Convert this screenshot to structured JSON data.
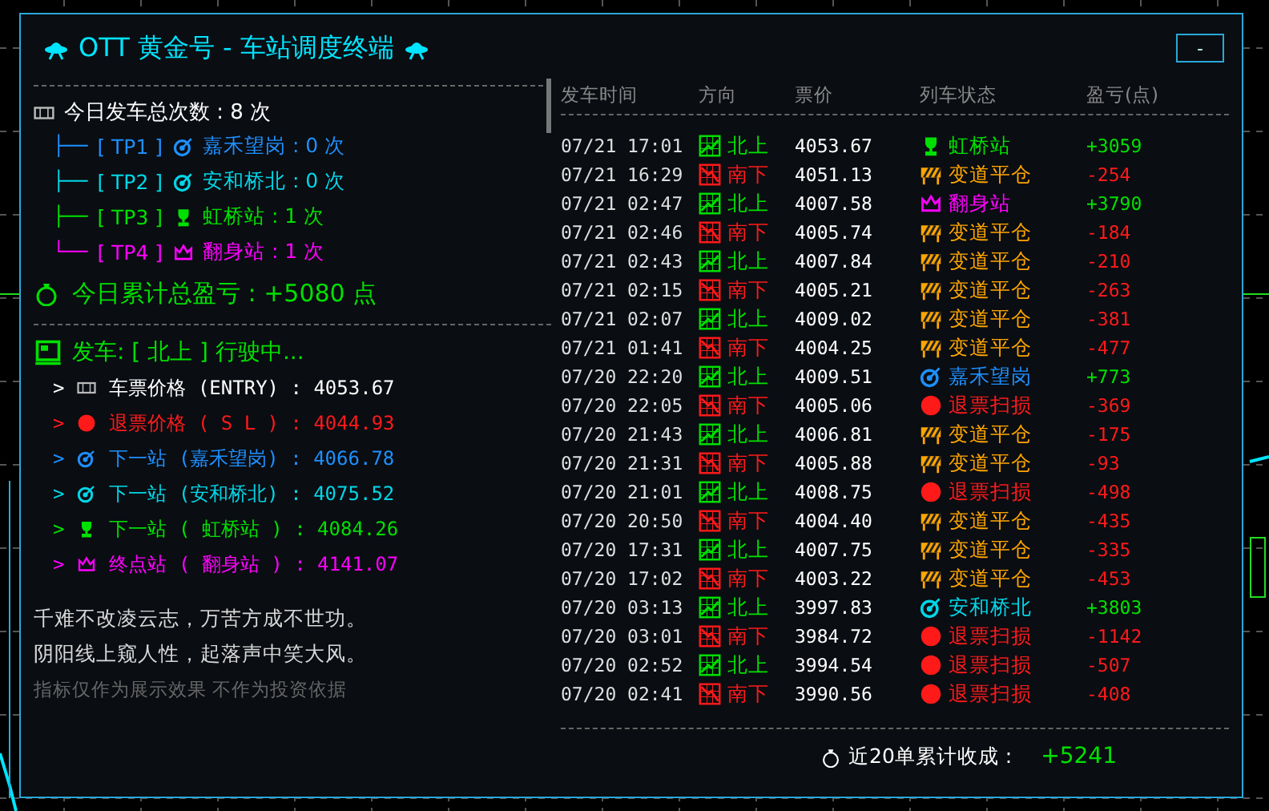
{
  "title": {
    "text": "OTT 黄金号 - 车站调度终端"
  },
  "minimize_button": {
    "label": "-"
  },
  "summary": {
    "text": "今日发车总次数 : 8 次"
  },
  "branches": [
    {
      "prefix": "├──",
      "tag": "[ TP1 ]",
      "station": "嘉禾望岗 : 0 次",
      "kind": "target",
      "color": "#1e90ff"
    },
    {
      "prefix": "├──",
      "tag": "[ TP2 ]",
      "station": "安和桥北 : 0 次",
      "kind": "target",
      "color": "#00d7e8"
    },
    {
      "prefix": "├──",
      "tag": "[ TP3 ]",
      "station": "虹桥站 : 1 次",
      "kind": "trophy",
      "color": "#00e000"
    },
    {
      "prefix": "└──",
      "tag": "[ TP4 ]",
      "station": "翻身站 : 1 次",
      "kind": "crown",
      "color": "#ff00ff"
    }
  ],
  "total": {
    "text": "今日累计总盈亏 : +5080 点"
  },
  "departure": {
    "text": "发车: [ 北上 ] 行驶中..."
  },
  "levels": [
    {
      "arrow": ">",
      "text": "车票价格 (ENTRY) : 4053.67",
      "kind": "ticket",
      "color": "#ffffff"
    },
    {
      "arrow": ">",
      "text": "退票价格 ( S L ) : 4044.93",
      "kind": "stop",
      "color": "#ff1a1a"
    },
    {
      "arrow": ">",
      "text": "下一站 (嘉禾望岗) : 4066.78",
      "kind": "target",
      "color": "#1e90ff"
    },
    {
      "arrow": ">",
      "text": "下一站 (安和桥北) : 4075.52",
      "kind": "target",
      "color": "#00d7e8"
    },
    {
      "arrow": ">",
      "text": "下一站 ( 虹桥站 ) : 4084.26",
      "kind": "trophy",
      "color": "#00e000"
    },
    {
      "arrow": ">",
      "text": "终点站 ( 翻身站 ) : 4141.07",
      "kind": "crown",
      "color": "#ff00ff"
    }
  ],
  "poem": [
    "千难不改凌云志，万苦方成不世功。",
    "阴阳线上窥人性，起落声中笑大风。"
  ],
  "disclaimer": "指标仅作为展示效果 不作为投资依据",
  "table": {
    "columns": [
      "发车时间",
      "方向",
      "票价",
      "列车状态",
      "盈亏(点)"
    ],
    "rows": [
      {
        "time": "07/21 17:01",
        "direction": {
          "kind": "up",
          "text": "北上"
        },
        "price": "4053.67",
        "status": {
          "kind": "trophy",
          "text": "虹桥站",
          "color": "#00e000"
        },
        "pnl": "+3059",
        "gain": true
      },
      {
        "time": "07/21 16:29",
        "direction": {
          "kind": "down",
          "text": "南下"
        },
        "price": "4051.13",
        "status": {
          "kind": "barrier",
          "text": "变道平仓",
          "color": "#ffa500"
        },
        "pnl": "-254",
        "gain": false
      },
      {
        "time": "07/21 02:47",
        "direction": {
          "kind": "up",
          "text": "北上"
        },
        "price": "4007.58",
        "status": {
          "kind": "crown",
          "text": "翻身站",
          "color": "#ff00ff"
        },
        "pnl": "+3790",
        "gain": true
      },
      {
        "time": "07/21 02:46",
        "direction": {
          "kind": "down",
          "text": "南下"
        },
        "price": "4005.74",
        "status": {
          "kind": "barrier",
          "text": "变道平仓",
          "color": "#ffa500"
        },
        "pnl": "-184",
        "gain": false
      },
      {
        "time": "07/21 02:43",
        "direction": {
          "kind": "up",
          "text": "北上"
        },
        "price": "4007.84",
        "status": {
          "kind": "barrier",
          "text": "变道平仓",
          "color": "#ffa500"
        },
        "pnl": "-210",
        "gain": false
      },
      {
        "time": "07/21 02:15",
        "direction": {
          "kind": "down",
          "text": "南下"
        },
        "price": "4005.21",
        "status": {
          "kind": "barrier",
          "text": "变道平仓",
          "color": "#ffa500"
        },
        "pnl": "-263",
        "gain": false
      },
      {
        "time": "07/21 02:07",
        "direction": {
          "kind": "up",
          "text": "北上"
        },
        "price": "4009.02",
        "status": {
          "kind": "barrier",
          "text": "变道平仓",
          "color": "#ffa500"
        },
        "pnl": "-381",
        "gain": false
      },
      {
        "time": "07/21 01:41",
        "direction": {
          "kind": "down",
          "text": "南下"
        },
        "price": "4004.25",
        "status": {
          "kind": "barrier",
          "text": "变道平仓",
          "color": "#ffa500"
        },
        "pnl": "-477",
        "gain": false
      },
      {
        "time": "07/20 22:20",
        "direction": {
          "kind": "up",
          "text": "北上"
        },
        "price": "4009.51",
        "status": {
          "kind": "target",
          "text": "嘉禾望岗",
          "color": "#1e90ff"
        },
        "pnl": "+773",
        "gain": true
      },
      {
        "time": "07/20 22:05",
        "direction": {
          "kind": "down",
          "text": "南下"
        },
        "price": "4005.06",
        "status": {
          "kind": "stop",
          "text": "退票扫损",
          "color": "#ff1a1a"
        },
        "pnl": "-369",
        "gain": false
      },
      {
        "time": "07/20 21:43",
        "direction": {
          "kind": "up",
          "text": "北上"
        },
        "price": "4006.81",
        "status": {
          "kind": "barrier",
          "text": "变道平仓",
          "color": "#ffa500"
        },
        "pnl": "-175",
        "gain": false
      },
      {
        "time": "07/20 21:31",
        "direction": {
          "kind": "down",
          "text": "南下"
        },
        "price": "4005.88",
        "status": {
          "kind": "barrier",
          "text": "变道平仓",
          "color": "#ffa500"
        },
        "pnl": "-93",
        "gain": false
      },
      {
        "time": "07/20 21:01",
        "direction": {
          "kind": "up",
          "text": "北上"
        },
        "price": "4008.75",
        "status": {
          "kind": "stop",
          "text": "退票扫损",
          "color": "#ff1a1a"
        },
        "pnl": "-498",
        "gain": false
      },
      {
        "time": "07/20 20:50",
        "direction": {
          "kind": "down",
          "text": "南下"
        },
        "price": "4004.40",
        "status": {
          "kind": "barrier",
          "text": "变道平仓",
          "color": "#ffa500"
        },
        "pnl": "-435",
        "gain": false
      },
      {
        "time": "07/20 17:31",
        "direction": {
          "kind": "up",
          "text": "北上"
        },
        "price": "4007.75",
        "status": {
          "kind": "barrier",
          "text": "变道平仓",
          "color": "#ffa500"
        },
        "pnl": "-335",
        "gain": false
      },
      {
        "time": "07/20 17:02",
        "direction": {
          "kind": "down",
          "text": "南下"
        },
        "price": "4003.22",
        "status": {
          "kind": "barrier",
          "text": "变道平仓",
          "color": "#ffa500"
        },
        "pnl": "-453",
        "gain": false
      },
      {
        "time": "07/20 03:13",
        "direction": {
          "kind": "up",
          "text": "北上"
        },
        "price": "3997.83",
        "status": {
          "kind": "target",
          "text": "安和桥北",
          "color": "#00d7e8"
        },
        "pnl": "+3803",
        "gain": true
      },
      {
        "time": "07/20 03:01",
        "direction": {
          "kind": "down",
          "text": "南下"
        },
        "price": "3984.72",
        "status": {
          "kind": "stop",
          "text": "退票扫损",
          "color": "#ff1a1a"
        },
        "pnl": "-1142",
        "gain": false
      },
      {
        "time": "07/20 02:52",
        "direction": {
          "kind": "up",
          "text": "北上"
        },
        "price": "3994.54",
        "status": {
          "kind": "stop",
          "text": "退票扫损",
          "color": "#ff1a1a"
        },
        "pnl": "-507",
        "gain": false
      },
      {
        "time": "07/20 02:41",
        "direction": {
          "kind": "down",
          "text": "南下"
        },
        "price": "3990.56",
        "status": {
          "kind": "stop",
          "text": "退票扫损",
          "color": "#ff1a1a"
        },
        "pnl": "-408",
        "gain": false
      }
    ]
  },
  "footer": {
    "label": "近20单累计收成 :",
    "value": "+5241",
    "gain": true
  }
}
